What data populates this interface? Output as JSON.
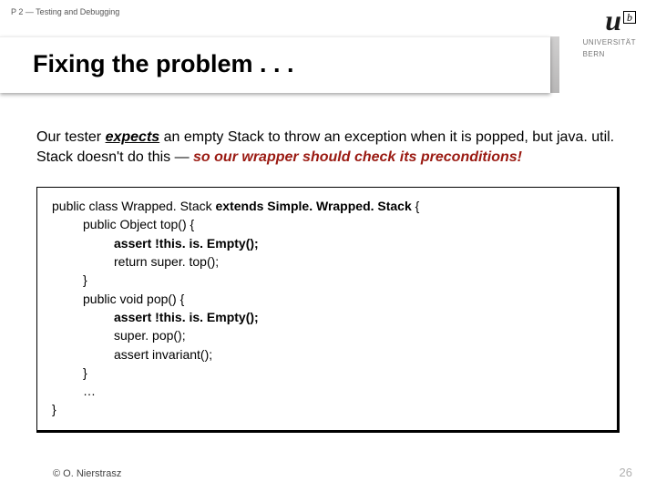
{
  "header": {
    "breadcrumb": "P 2 — Testing and Debugging",
    "title": "Fixing the problem . . ."
  },
  "logo": {
    "u": "u",
    "b": "b",
    "line1": "UNIVERSITÄT",
    "line2": "BERN"
  },
  "lead": {
    "part1": "Our tester ",
    "em": "expects",
    "part2": " an empty Stack to throw an exception when it is popped, but java. util. Stack doesn't do this — ",
    "tail": "so our wrapper should check its preconditions!"
  },
  "code": {
    "l1a": "public class Wrapped. Stack ",
    "l1b": "extends Simple. Wrapped. Stack",
    "l1c": " {",
    "l2": "public Object top() {",
    "l3": "assert !this. is. Empty();",
    "l4": "return super. top();",
    "l5": "}",
    "l6": "public void pop() {",
    "l7": "assert !this. is. Empty();",
    "l8": "super. pop();",
    "l9": "assert invariant();",
    "l10": "}",
    "l11": "…",
    "l12": "}"
  },
  "footer": {
    "copyright": "© O. Nierstrasz",
    "page": "26"
  }
}
